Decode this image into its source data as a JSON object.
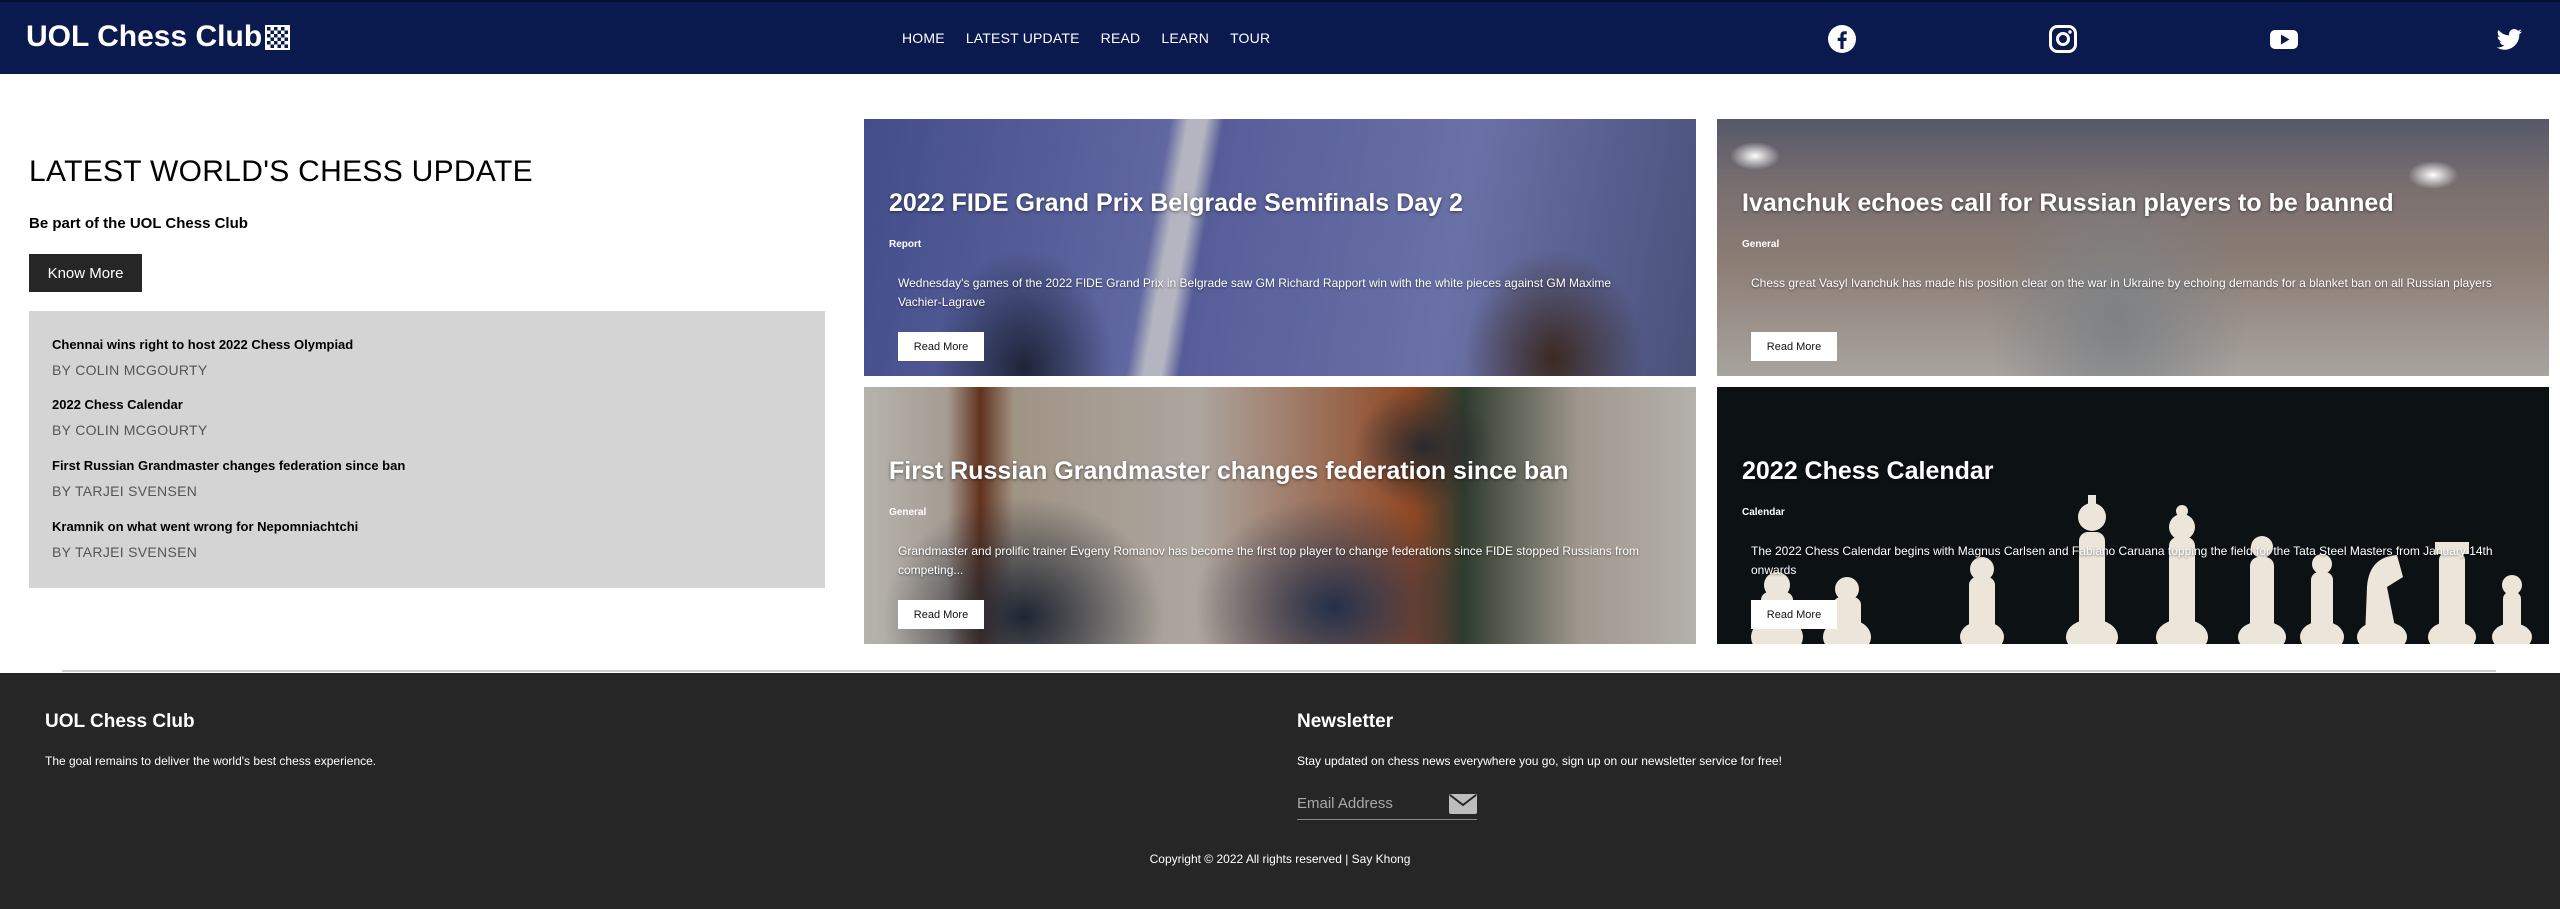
{
  "header": {
    "brand": "UOL Chess Club",
    "nav": [
      "HOME",
      "LATEST UPDATE",
      "READ",
      "LEARN",
      "TOUR"
    ],
    "social": [
      "facebook-icon",
      "instagram-icon",
      "youtube-icon",
      "twitter-icon"
    ],
    "bg_color": "#0a1a4f"
  },
  "hero": {
    "title": "LATEST WORLD'S CHESS UPDATE",
    "subtitle": "Be part of the UOL Chess Club",
    "button": "Know More"
  },
  "news": [
    {
      "title": "Chennai wins right to host 2022 Chess Olympiad",
      "author": "BY COLIN MCGOURTY"
    },
    {
      "title": "2022 Chess Calendar",
      "author": "BY COLIN MCGOURTY"
    },
    {
      "title": "First Russian Grandmaster changes federation since ban",
      "author": "BY TARJEI SVENSEN"
    },
    {
      "title": "Kramnik on what went wrong for Nepomniachtchi",
      "author": "BY TARJEI SVENSEN"
    }
  ],
  "cards": [
    {
      "title": "2022 FIDE Grand Prix Belgrade Semifinals Day 2",
      "category": "Report",
      "description": "Wednesday's games of the 2022 FIDE Grand Prix in Belgrade saw GM Richard Rapport win with the white pieces against GM Maxime Vachier-Lagrave",
      "button": "Read More"
    },
    {
      "title": "Ivanchuk echoes call for Russian players to be banned",
      "category": "General",
      "description": "Chess great Vasyl Ivanchuk has made his position clear on the war in Ukraine by echoing demands for a blanket ban on all Russian players",
      "button": "Read More"
    },
    {
      "title": "First Russian Grandmaster changes federation since ban",
      "category": "General",
      "description": "Grandmaster and prolific trainer Evgeny Romanov has become the first top player to change federations since FIDE stopped Russians from competing...",
      "button": "Read More"
    },
    {
      "title": "2022 Chess Calendar",
      "category": "Calendar",
      "description": "The 2022 Chess Calendar begins with Magnus Carlsen and Fabiano Caruana topping the field for the Tata Steel Masters from January 14th onwards",
      "button": "Read More"
    }
  ],
  "footer": {
    "club_title": "UOL Chess Club",
    "club_text": "The goal remains to deliver the world's best chess experience.",
    "newsletter_title": "Newsletter",
    "newsletter_text": "Stay updated on chess news everywhere you go, sign up on our newsletter service for free!",
    "email_placeholder": "Email Address",
    "copyright": "Copyright © 2022 All rights reserved | Say Khong"
  }
}
